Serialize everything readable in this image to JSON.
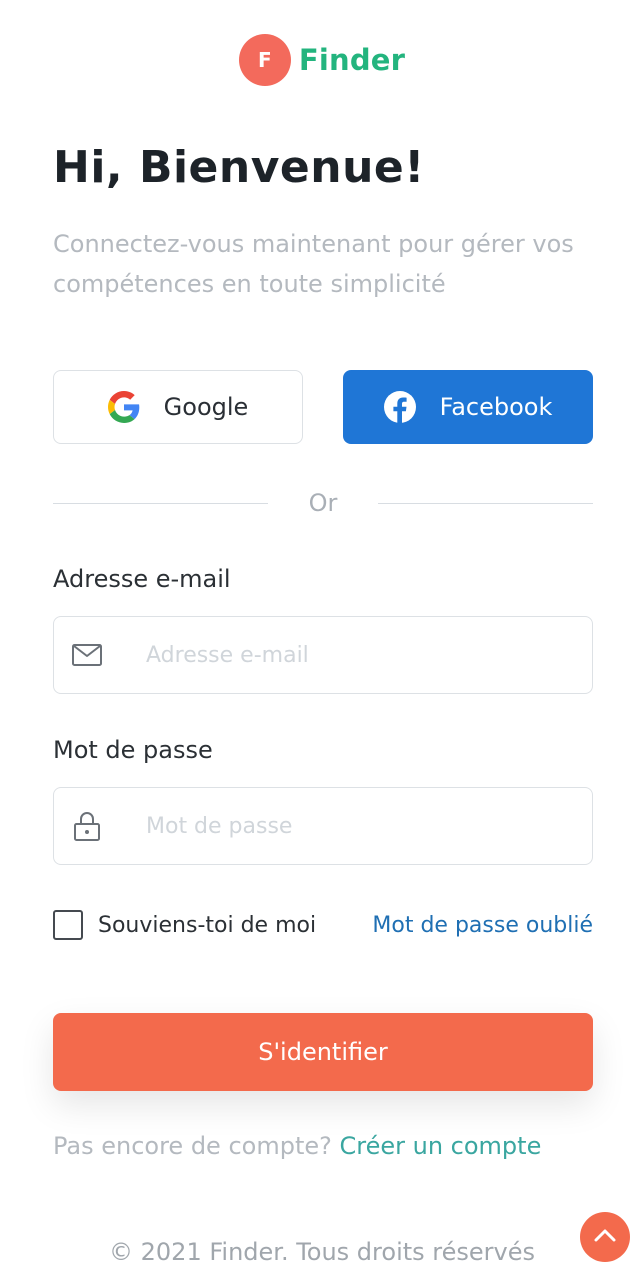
{
  "brand": {
    "logo_letter": "F",
    "name": "Finder",
    "mark_color": "#f36a5c",
    "name_color": "#23b47e"
  },
  "header": {
    "title": "Hi, Bienvenue!",
    "subtitle": "Connectez-vous maintenant pour gérer vos compétences en toute simplicité"
  },
  "social": {
    "google_label": "Google",
    "facebook_label": "Facebook",
    "facebook_color": "#1f76d6"
  },
  "divider": {
    "text": "Or"
  },
  "form": {
    "email_label": "Adresse e-mail",
    "email_placeholder": "Adresse e-mail",
    "email_value": "",
    "password_label": "Mot de passe",
    "password_placeholder": "Mot de passe",
    "password_value": "",
    "remember_label": "Souviens-toi de moi",
    "remember_checked": false,
    "forgot_label": "Mot de passe oublié",
    "submit_label": "S'identifier",
    "submit_color": "#f36a4c"
  },
  "signup": {
    "prompt": "Pas encore de compte?",
    "link_label": "Créer un compte"
  },
  "footer": {
    "copyright": "© 2021 Finder. Tous droits réservés"
  },
  "icons": {
    "google": "google-icon",
    "facebook": "facebook-icon",
    "email": "envelope-icon",
    "password": "lock-icon",
    "scroll_top": "chevron-up-icon"
  }
}
